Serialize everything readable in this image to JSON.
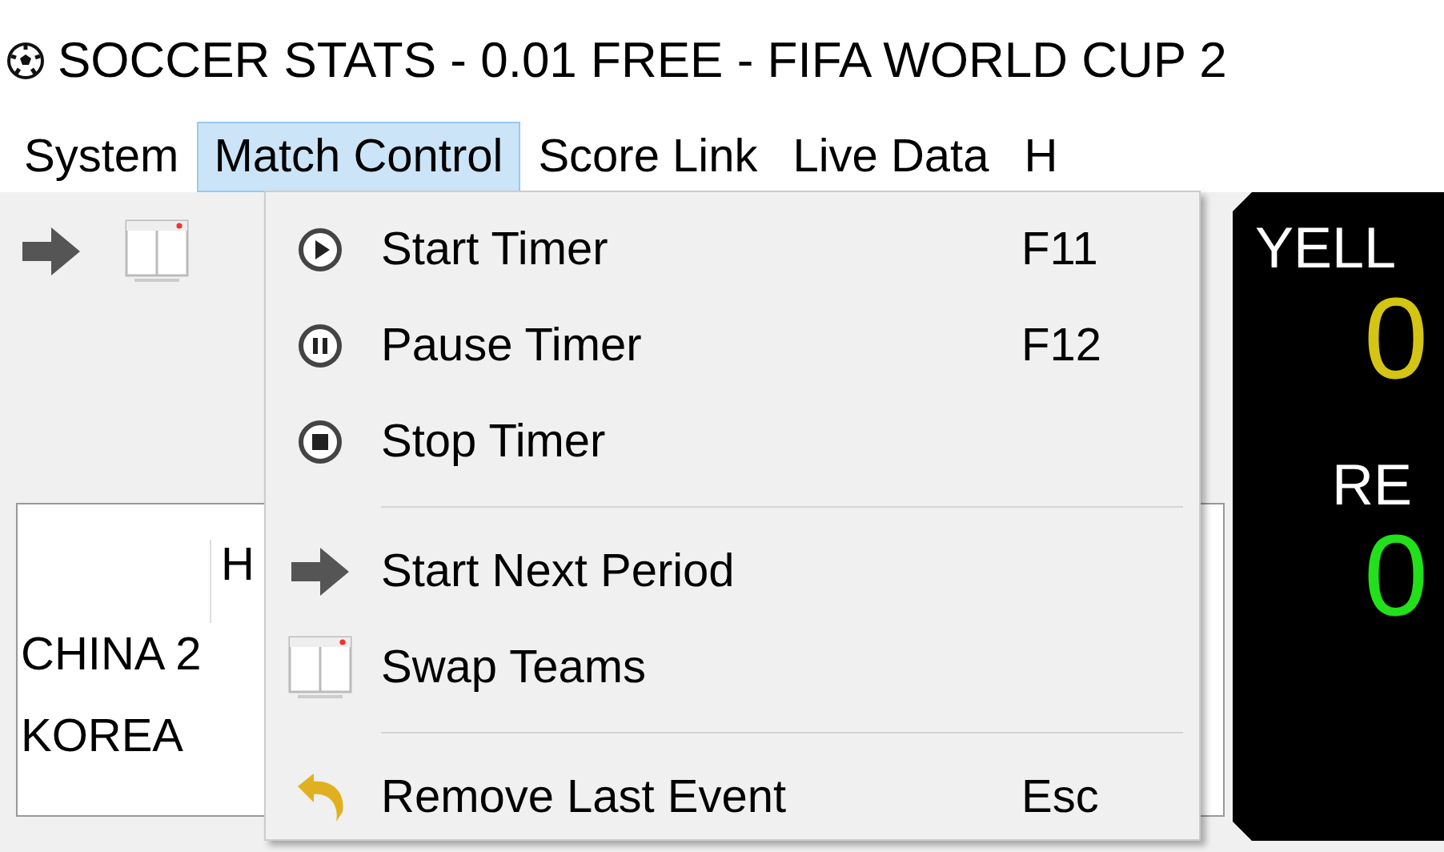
{
  "window": {
    "title": "SOCCER STATS - 0.01 FREE - FIFA WORLD CUP 2"
  },
  "menu_bar": [
    {
      "label": "System",
      "selected": false
    },
    {
      "label": "Match Control",
      "selected": true
    },
    {
      "label": "Score Link",
      "selected": false
    },
    {
      "label": "Live Data",
      "selected": false
    },
    {
      "label": "H",
      "selected": false
    }
  ],
  "toolbar": [
    {
      "kind": "arrow"
    },
    {
      "kind": "window"
    }
  ],
  "table": {
    "columns": [
      "H"
    ],
    "rows": [
      "CHINA 2",
      "KOREA"
    ]
  },
  "cards": [
    {
      "label": "YELL",
      "value": "0",
      "color": "#d4c414"
    },
    {
      "label": "RE",
      "value": "0",
      "color": "#22e01a"
    }
  ],
  "dropdown": {
    "items": [
      {
        "kind": "play",
        "label": "Start Timer",
        "shortcut": "F11"
      },
      {
        "kind": "pause",
        "label": "Pause Timer",
        "shortcut": "F12"
      },
      {
        "kind": "stop",
        "label": "Stop Timer"
      },
      {
        "kind": "separator"
      },
      {
        "kind": "arrow",
        "label": "Start Next Period"
      },
      {
        "kind": "window",
        "label": "Swap Teams"
      },
      {
        "kind": "separator"
      },
      {
        "kind": "undo",
        "label": "Remove Last Event",
        "shortcut": "Esc"
      }
    ]
  }
}
